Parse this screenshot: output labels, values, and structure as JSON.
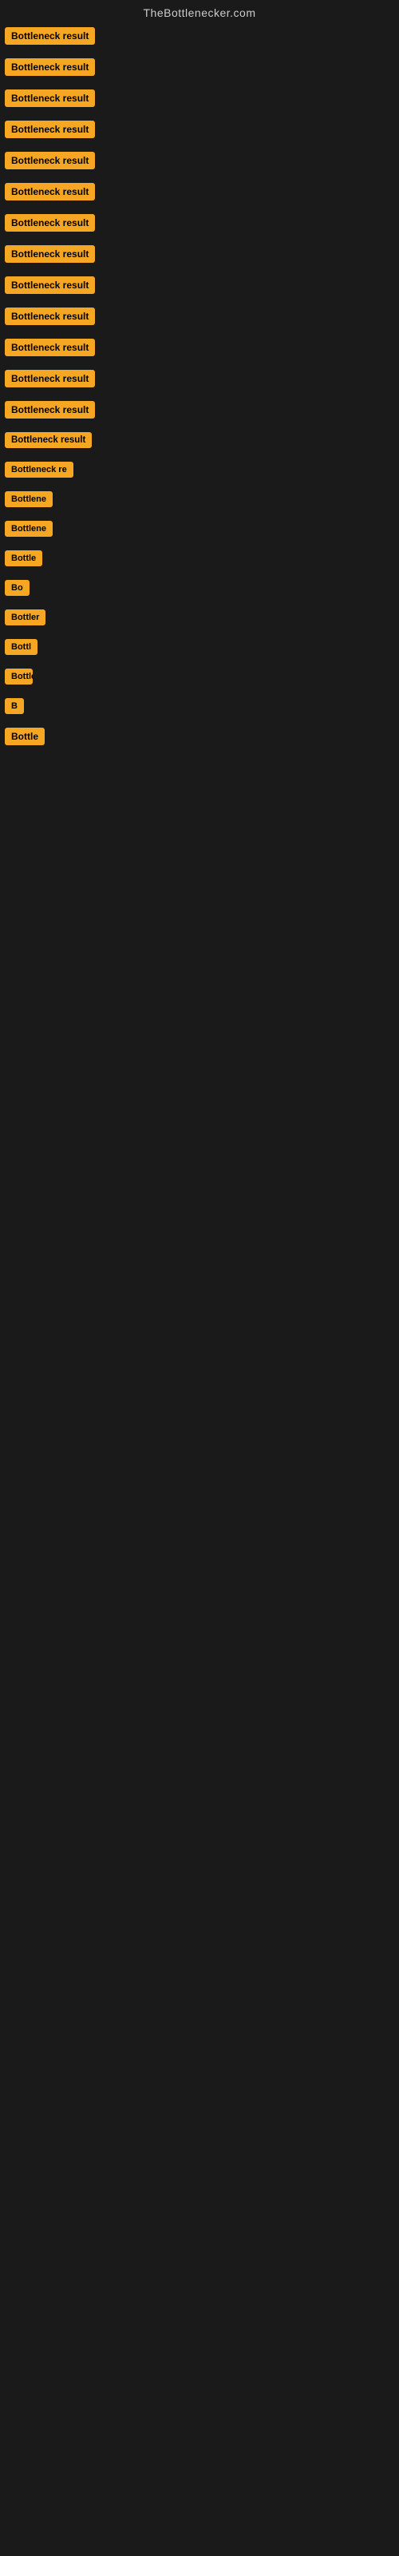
{
  "site": {
    "title": "TheBottlenecker.com"
  },
  "badges": [
    {
      "id": 1,
      "label": "Bottleneck result",
      "row_class": "row-1"
    },
    {
      "id": 2,
      "label": "Bottleneck result",
      "row_class": "row-2"
    },
    {
      "id": 3,
      "label": "Bottleneck result",
      "row_class": "row-3"
    },
    {
      "id": 4,
      "label": "Bottleneck result",
      "row_class": "row-4"
    },
    {
      "id": 5,
      "label": "Bottleneck result",
      "row_class": "row-5"
    },
    {
      "id": 6,
      "label": "Bottleneck result",
      "row_class": "row-6"
    },
    {
      "id": 7,
      "label": "Bottleneck result",
      "row_class": "row-7"
    },
    {
      "id": 8,
      "label": "Bottleneck result",
      "row_class": "row-8"
    },
    {
      "id": 9,
      "label": "Bottleneck result",
      "row_class": "row-9"
    },
    {
      "id": 10,
      "label": "Bottleneck result",
      "row_class": "row-10"
    },
    {
      "id": 11,
      "label": "Bottleneck result",
      "row_class": "row-11"
    },
    {
      "id": 12,
      "label": "Bottleneck result",
      "row_class": "row-12"
    },
    {
      "id": 13,
      "label": "Bottleneck result",
      "row_class": "row-13"
    },
    {
      "id": 14,
      "label": "Bottleneck result",
      "row_class": "row-14"
    },
    {
      "id": 15,
      "label": "Bottleneck re",
      "row_class": "row-15"
    },
    {
      "id": 16,
      "label": "Bottlene",
      "row_class": "row-16"
    },
    {
      "id": 17,
      "label": "Bottlene",
      "row_class": "row-17"
    },
    {
      "id": 18,
      "label": "Bottle",
      "row_class": "row-18"
    },
    {
      "id": 19,
      "label": "Bo",
      "row_class": "row-19"
    },
    {
      "id": 20,
      "label": "Bottler",
      "row_class": "row-20"
    },
    {
      "id": 21,
      "label": "Bottl",
      "row_class": "row-21"
    },
    {
      "id": 22,
      "label": "Bottlene",
      "row_class": "row-22"
    },
    {
      "id": 23,
      "label": "B",
      "row_class": "row-23"
    },
    {
      "id": 24,
      "label": "Bottle",
      "row_class": "row-24"
    }
  ]
}
